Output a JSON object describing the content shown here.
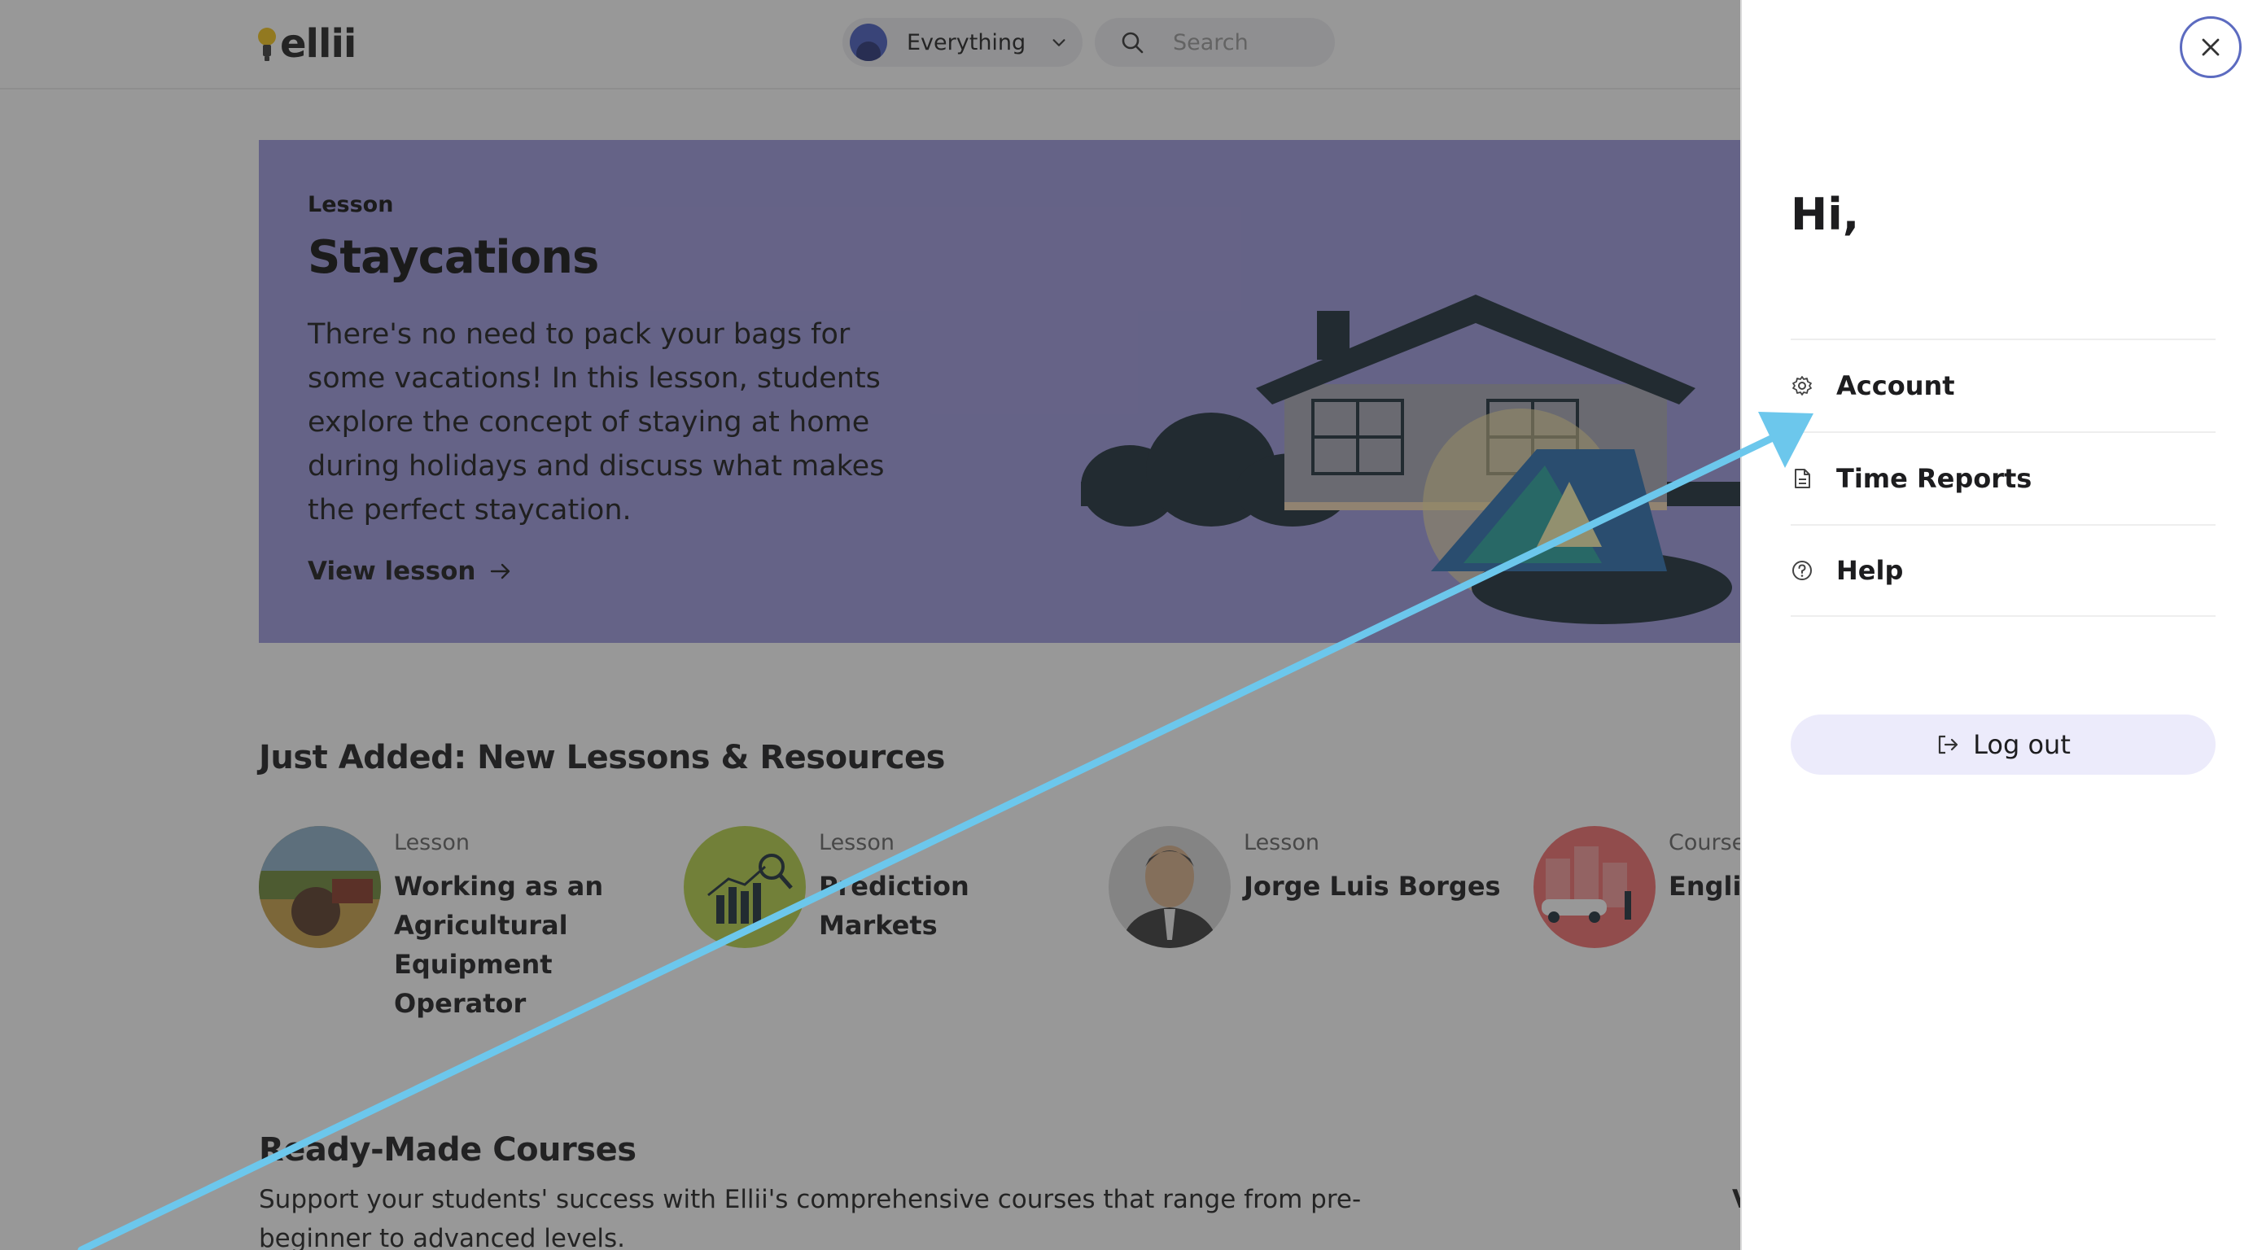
{
  "header": {
    "logo_text": "ellii",
    "scope_label": "Everything",
    "search_placeholder": "Search"
  },
  "hero": {
    "kicker": "Lesson",
    "title": "Staycations",
    "description": "There's no need to pack your bags for some vacations! In this lesson, students explore the concept of staying at home during holidays and discuss what makes the perfect staycation.",
    "link_label": "View lesson"
  },
  "just_added": {
    "title": "Just Added: New Lessons & Resources",
    "items": [
      {
        "kicker": "Lesson",
        "title": "Working as an Agricultural Equipment Operator",
        "thumb_color": "#c9a24a"
      },
      {
        "kicker": "Lesson",
        "title": "Prediction Markets",
        "thumb_color": "#b7d24a"
      },
      {
        "kicker": "Lesson",
        "title": "Jorge Luis Borges",
        "thumb_color": "#d8d8d8"
      },
      {
        "kicker": "Course",
        "title": "English",
        "thumb_color": "#f26d6d"
      }
    ]
  },
  "courses": {
    "title": "Ready-Made Courses",
    "description": "Support your students' success with Ellii's comprehensive courses that range from pre-beginner to advanced levels.",
    "view_all_peek": "V"
  },
  "drawer": {
    "greeting": "Hi,",
    "menu": [
      {
        "label": "Account",
        "icon": "gear-icon"
      },
      {
        "label": "Time Reports",
        "icon": "document-icon"
      },
      {
        "label": "Help",
        "icon": "help-circle-icon"
      }
    ],
    "logout_label": "Log out",
    "close_icon": "close-icon"
  },
  "colors": {
    "hero_bg": "#9e9adf",
    "accent": "#5c6bc0",
    "logout_bg": "#ecebfb",
    "annotation_arrow": "#6cc7ec"
  }
}
